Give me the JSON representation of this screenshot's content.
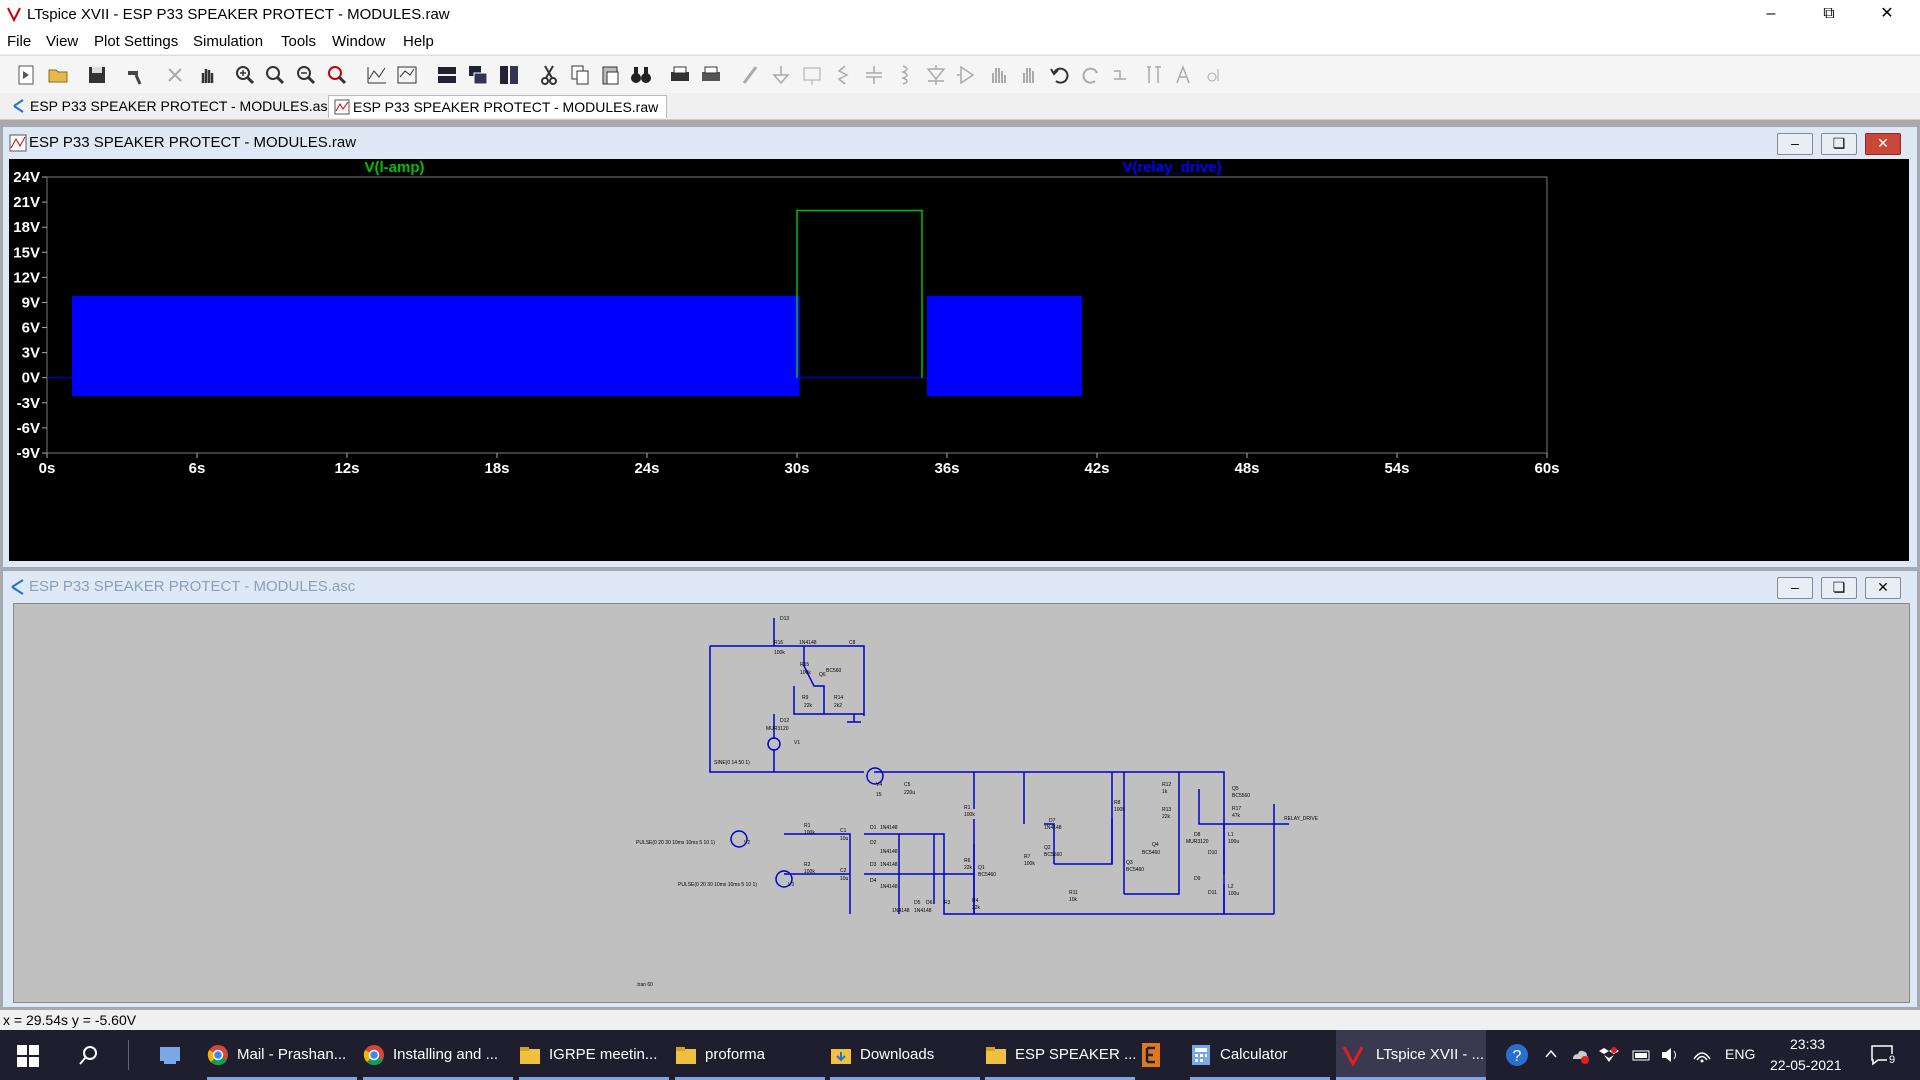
{
  "window": {
    "title": "LTspice XVII - ESP P33 SPEAKER PROTECT - MODULES.raw"
  },
  "menu": [
    "File",
    "View",
    "Plot Settings",
    "Simulation",
    "Tools",
    "Window",
    "Help"
  ],
  "tabs": [
    {
      "label": "ESP P33 SPEAKER PROTECT - MODULES.asc",
      "active": false
    },
    {
      "label": "ESP P33 SPEAKER PROTECT - MODULES.raw",
      "active": true
    }
  ],
  "plot_window": {
    "title": "ESP P33 SPEAKER PROTECT - MODULES.raw"
  },
  "schematic_window": {
    "title": "ESP P33 SPEAKER PROTECT - MODULES.asc"
  },
  "chart_data": {
    "type": "line",
    "series": [
      {
        "name": "V(l-amp)",
        "color": "#00c000",
        "segments": [
          {
            "x": [
              30,
              30,
              35,
              35
            ],
            "y": [
              0,
              20,
              20,
              0
            ]
          }
        ]
      },
      {
        "name": "V(relay_drive)",
        "color": "#0000ff",
        "bands": [
          {
            "x0": 1,
            "x1": 30.1,
            "ymin": -2.2,
            "ymax": 9.8
          },
          {
            "x0": 35.2,
            "x1": 41.4,
            "ymin": -2.2,
            "ymax": 9.8
          }
        ],
        "baseline": [
          {
            "x0": 0,
            "x1": 1,
            "y": 0
          },
          {
            "x0": 30.1,
            "x1": 35.2,
            "y": 0
          }
        ]
      }
    ],
    "xticks": [
      "0s",
      "6s",
      "12s",
      "18s",
      "24s",
      "30s",
      "36s",
      "42s",
      "48s",
      "54s",
      "60s"
    ],
    "yticks": [
      "24V",
      "21V",
      "18V",
      "15V",
      "12V",
      "9V",
      "6V",
      "3V",
      "0V",
      "-3V",
      "-6V",
      "-9V"
    ],
    "xlim": [
      0,
      60
    ],
    "ylim": [
      -9,
      24
    ],
    "grid": false
  },
  "schematic": {
    "labels": [
      "D13",
      "R16",
      "1N4148",
      "C8",
      "100k",
      "R15",
      "100k",
      "Q6",
      "BC560",
      "R9",
      "R14",
      "22k",
      "2k2",
      "D12",
      "MUR3120",
      "V1",
      "SINE(0 14 50 1)",
      "V4",
      "C5",
      "15",
      "220u",
      "R1",
      "100k",
      "D7",
      "1N4148",
      "Q2",
      "BC5560",
      "R8",
      "100k",
      "R12",
      "1k",
      "Q5",
      "BC5560",
      "R13",
      "22k",
      "BC5460",
      "Q4",
      "R17",
      "47k",
      "RELAY_DRIVE",
      "R1",
      "100k",
      "C1",
      "10u",
      "D1",
      "1N4148",
      "D2",
      "1N4148",
      "PULSE(0 20 30 10ms 10ms 5 10 1)",
      "V2",
      "R2",
      "100k",
      "C2",
      "10u",
      "D3",
      "1N4148",
      "D4",
      "1N4148",
      "PULSE(0 20 30 10ms 10ms 5 10 1)",
      "V3",
      "R6",
      "22k",
      "Q1",
      "BC5460",
      "R7",
      "100k",
      "R11",
      "10k",
      "Q3",
      "BC5460",
      "D8",
      "MUR3120",
      "D10",
      "D9",
      "D11",
      "L1",
      "100u",
      "L2",
      "100u",
      "D5",
      "D6",
      "R3",
      "R4",
      "22k",
      "1N4148",
      "1N4148",
      ".tran 60"
    ]
  },
  "status": {
    "coords": "x = 29.54s    y = -5.60V"
  },
  "taskbar": {
    "items": [
      "Mail - Prashan...",
      "Installing and ...",
      "IGRPE meetin...",
      "proforma",
      "Downloads",
      "ESP SPEAKER ...",
      "Calculator",
      "LTspice XVII - ..."
    ],
    "lang": "ENG",
    "time": "23:33",
    "date": "22-05-2021",
    "notifications": "9"
  }
}
